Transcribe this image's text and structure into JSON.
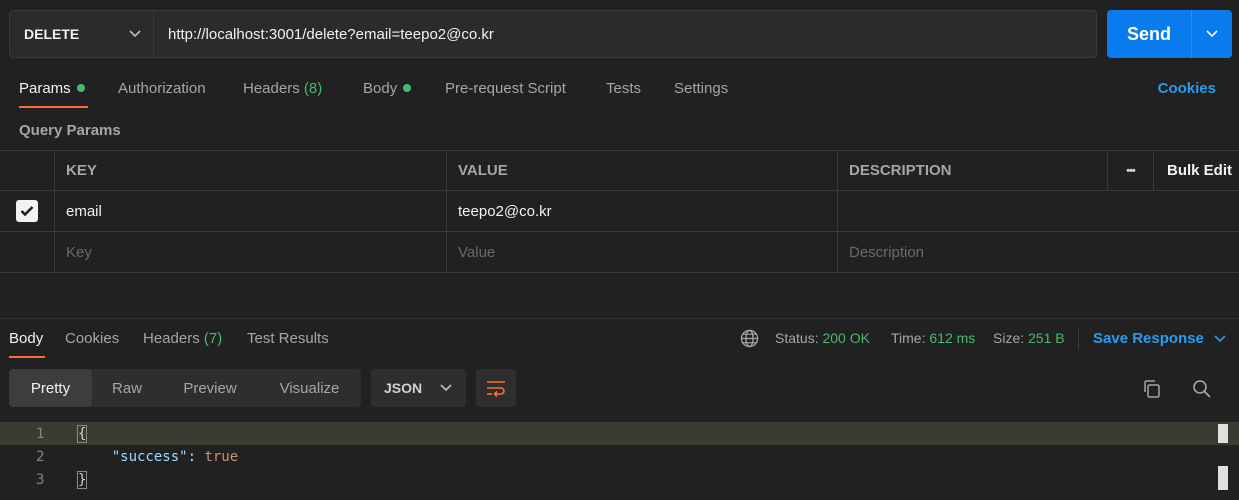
{
  "request": {
    "method": "DELETE",
    "url": "http://localhost:3001/delete?email=teepo2@co.kr",
    "send_label": "Send"
  },
  "request_tabs": {
    "params": "Params",
    "authorization": "Authorization",
    "headers": "Headers",
    "headers_count": "(8)",
    "body": "Body",
    "prerequest": "Pre-request Script",
    "tests": "Tests",
    "settings": "Settings",
    "cookies": "Cookies"
  },
  "query_params": {
    "title": "Query Params",
    "columns": [
      "KEY",
      "VALUE",
      "DESCRIPTION"
    ],
    "more_label": "•••",
    "bulk_edit": "Bulk Edit",
    "rows": [
      {
        "checked": true,
        "key": "email",
        "value": "teepo2@co.kr",
        "description": ""
      }
    ],
    "placeholders": {
      "key": "Key",
      "value": "Value",
      "description": "Description"
    }
  },
  "response_tabs": {
    "body": "Body",
    "cookies": "Cookies",
    "headers": "Headers",
    "headers_count": "(7)",
    "test_results": "Test Results"
  },
  "response_status": {
    "status_label": "Status:",
    "status_value": "200 OK",
    "time_label": "Time:",
    "time_value": "612 ms",
    "size_label": "Size:",
    "size_value": "251 B",
    "save_response": "Save Response"
  },
  "view": {
    "pretty": "Pretty",
    "raw": "Raw",
    "preview": "Preview",
    "visualize": "Visualize",
    "format": "JSON"
  },
  "code": {
    "line_numbers": [
      "1",
      "2",
      "3"
    ],
    "open_brace": "{",
    "key": "\"success\"",
    "colon": ": ",
    "value": "true",
    "close_brace": "}"
  },
  "colors": {
    "accent": "#ff6c37",
    "send": "#097bed",
    "link": "#2a9cf0",
    "success": "#49b96b",
    "background": "#212121"
  }
}
